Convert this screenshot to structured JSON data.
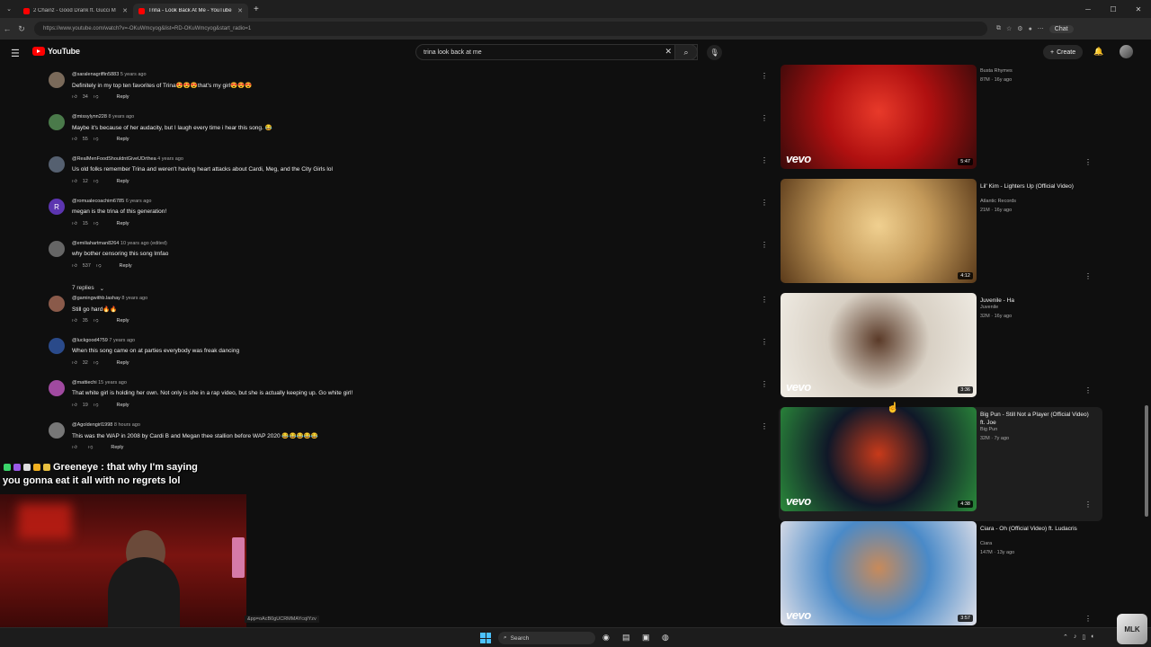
{
  "browser": {
    "tabs": [
      {
        "title": "2 Chainz - Good Drank ft. Gucci M",
        "active": false
      },
      {
        "title": "Trina - Look Back At Me - YouTube",
        "active": true
      }
    ],
    "url": "https://www.youtube.com/watch?v=-OKuWmcyog&list=RD-OKuWmcyog&start_radio=1",
    "chat_label": "Chat"
  },
  "youtube": {
    "logo_text": "YouTube",
    "search_value": "trina look back at me",
    "create_label": "Create"
  },
  "comments": [
    {
      "handle": "@saralenagriffin5883",
      "time": "5 years ago",
      "text": "Definitely in my top ten favorites of Trina😍😍😍that's my girl😍😍😍",
      "likes": "34",
      "avatar_color": "#7a6a5a",
      "avatar_letter": ""
    },
    {
      "handle": "@missylynn228",
      "time": "8 years ago",
      "text": "Maybe it's because of her audacity, but I laugh every time i hear this song. 😂",
      "likes": "55",
      "avatar_color": "#4a7a4a",
      "avatar_letter": ""
    },
    {
      "handle": "@RealMenFoodShouldntGiveUDrthea",
      "time": "4 years ago",
      "text": "Us old folks remember Trina and weren't having heart attacks about Cardi, Meg, and the City Girls lol",
      "likes": "12",
      "avatar_color": "#556070",
      "avatar_letter": ""
    },
    {
      "handle": "@romualecoachim6785",
      "time": "6 years ago",
      "text": "megan is the trina of this generation!",
      "likes": "15",
      "avatar_color": "#5c35b0",
      "avatar_letter": "R"
    },
    {
      "handle": "@emiliahartman8264",
      "time": "10 years ago (edited)",
      "text": "why bother censoring this song lmfao",
      "likes": "537",
      "avatar_color": "#666666",
      "avatar_letter": ""
    },
    {
      "handle": "@gamingwithb.lashay",
      "time": "8 years ago",
      "text": "Still go hard🔥🔥",
      "likes": "35",
      "avatar_color": "#8a5a4a",
      "avatar_letter": ""
    },
    {
      "handle": "@luckgood4759",
      "time": "7 years ago",
      "text": "When this song came on at parties everybody was freak dancing",
      "likes": "32",
      "avatar_color": "#2a4a8a",
      "avatar_letter": ""
    },
    {
      "handle": "@mattiechi",
      "time": "15 years ago",
      "text": "That white girl is holding her own. Not only is she in a rap video, but she is actually keeping up. Go white girl!",
      "likes": "19",
      "avatar_color": "#a04aa0",
      "avatar_letter": ""
    },
    {
      "handle": "@Agoldengirl1998",
      "time": "8 hours ago",
      "text": "This was the WAP in 2008 by Cardi B and Megan thee stallion before WAP 2020 😂😂😂😂😂",
      "likes": "",
      "avatar_color": "#777777",
      "avatar_letter": ""
    }
  ],
  "reply_label": "Reply",
  "replies_toggle": "7 replies",
  "chat_overlay": {
    "user": "Greeneye",
    "message_line1": ": that why I'm saying",
    "message_line2": "you gonna eat it all with no regrets lol"
  },
  "link_hint": "&pp=oAcB0gUCRMMAYcqIYzv",
  "recommendations": [
    {
      "title": "",
      "channel": "Busta Rhymes",
      "views": "87M · 16y ago",
      "duration": "5:47",
      "vevo": true,
      "colors": [
        "#b01010",
        "#e83a2a",
        "#3a0a0a"
      ]
    },
    {
      "title": "Lil' Kim - Lighters Up (Official Video)",
      "channel": "Atlantic Records",
      "views": "21M · 16y ago",
      "duration": "4:12",
      "vevo": false,
      "colors": [
        "#c49a5a",
        "#f0d090",
        "#5a3a1a"
      ]
    },
    {
      "title": "Juvenile - Ha",
      "channel": "Juvenile",
      "views": "32M · 16y ago",
      "duration": "3:36",
      "vevo": true,
      "colors": [
        "#d8d0c4",
        "#5a3a28",
        "#f0ece4"
      ]
    },
    {
      "title": "Big Pun - Still Not a Player (Official Video) ft. Joe",
      "channel": "Big Pun",
      "views": "32M · 7y ago",
      "duration": "4:38",
      "vevo": true,
      "colors": [
        "#101828",
        "#c83a1a",
        "#2a8a3a"
      ]
    },
    {
      "title": "Ciara - Oh (Official Video) ft. Ludacris",
      "channel": "Ciara",
      "views": "147M · 13y ago",
      "duration": "3:57",
      "vevo": true,
      "colors": [
        "#4a8ac8",
        "#c88a5a",
        "#e0e0e8"
      ]
    }
  ],
  "taskbar": {
    "search_label": "Search"
  }
}
